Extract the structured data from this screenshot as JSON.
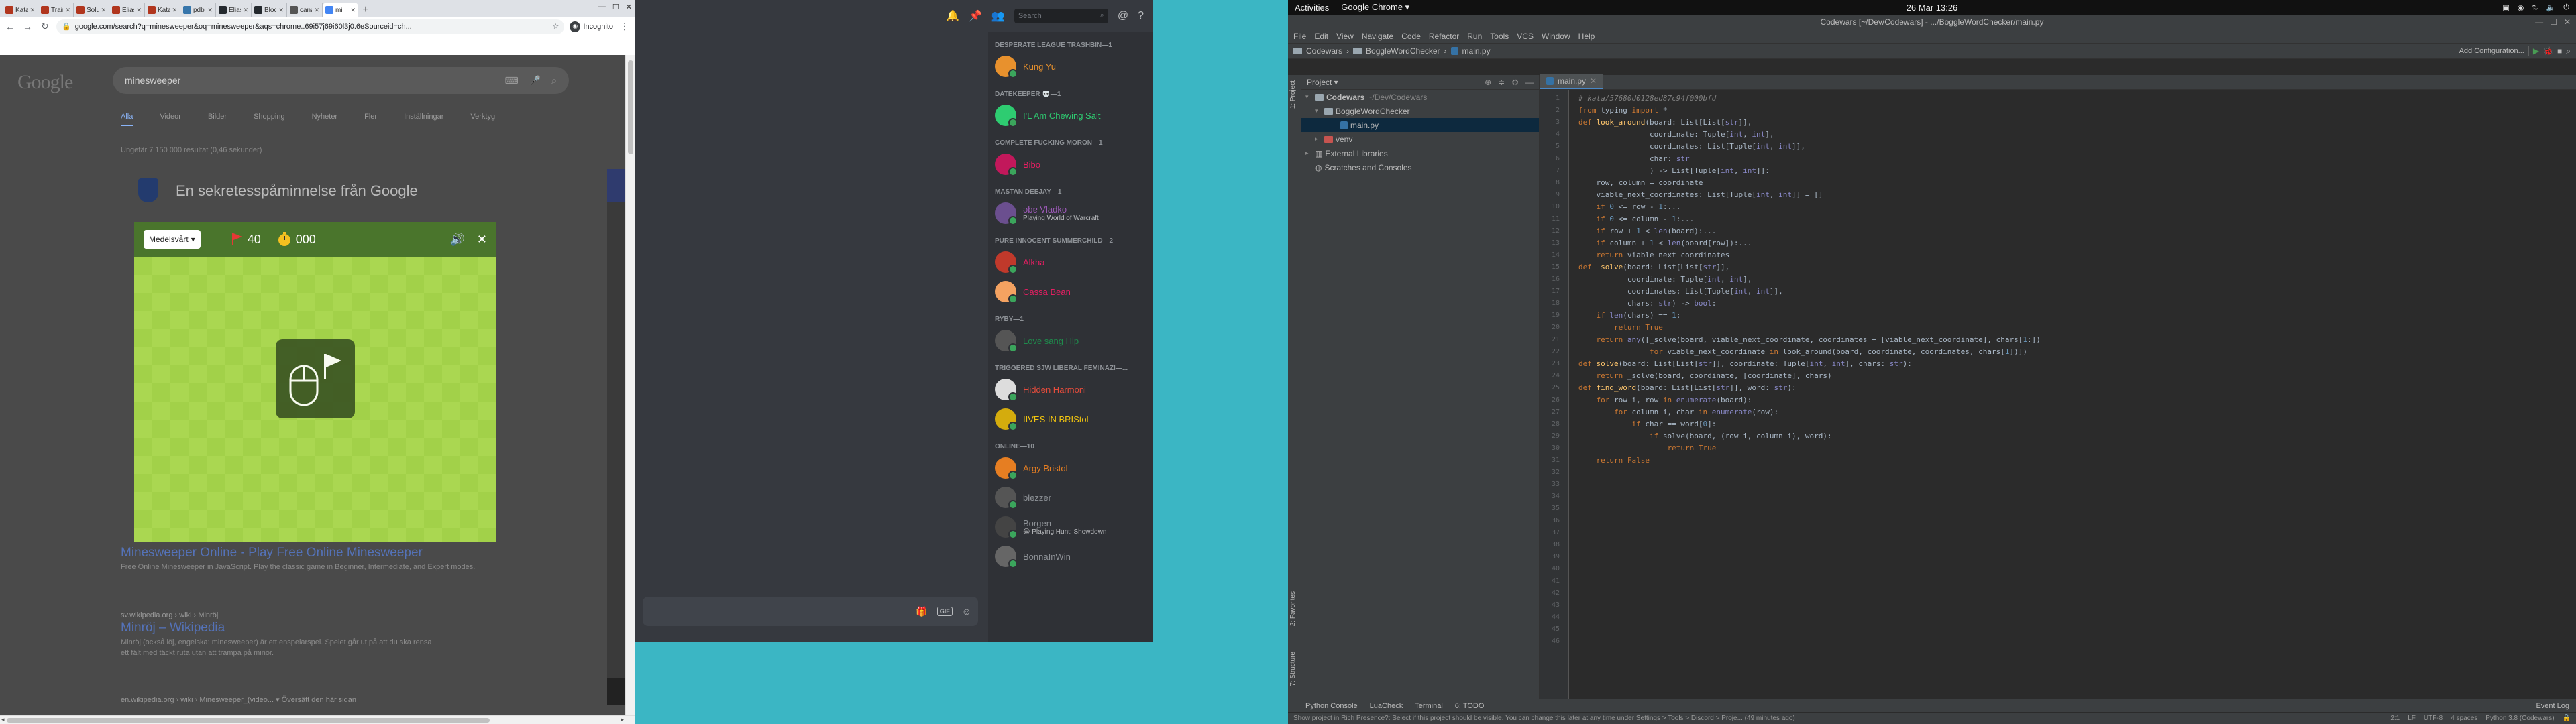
{
  "chrome": {
    "tabs": [
      {
        "label": "Kata |",
        "color": "#b1361e"
      },
      {
        "label": "Train",
        "color": "#b1361e"
      },
      {
        "label": "Solut",
        "color": "#b1361e"
      },
      {
        "label": "Elias",
        "color": "#b1361e"
      },
      {
        "label": "Kata |",
        "color": "#b1361e"
      },
      {
        "label": "pdb -",
        "color": "#3776ab"
      },
      {
        "label": "Elias",
        "color": "#24292e"
      },
      {
        "label": "Block",
        "color": "#24292e"
      },
      {
        "label": "cana",
        "color": "#555555"
      },
      {
        "label": "mi",
        "color": "#4285f4",
        "active": true
      }
    ],
    "url": "google.com/search?q=minesweeper&oq=minesweeper&aqs=chrome..69i57j69i60l3j0.6eSourceid=ch...",
    "profile": "Incognito",
    "search_query": "minesweeper",
    "nav_tabs": [
      "Alla",
      "Videor",
      "Bilder",
      "Shopping",
      "Nyheter",
      "Fler",
      "Inställningar",
      "Verktyg"
    ],
    "result_stats": "Ungefär 7 150 000 resultat (0,46 sekunder)",
    "privacy_title": "En sekretesspåminnelse från Google",
    "result1": {
      "title": "Minesweeper Online - Play Free Online Minesweeper",
      "desc": "Free Online Minesweeper in JavaScript. Play the classic game in Beginner, Intermediate, and Expert modes."
    },
    "result2": {
      "source": "sv.wikipedia.org › wiki › Minröj",
      "title": "Minröj – Wikipedia",
      "desc1": "Minröj (också löj, engelska: minesweeper) är ett enspelarspel. Spelet går ut på att du ska rensa",
      "desc2": "ett fält med täckt ruta utan att trampa på minor."
    },
    "footer_text": "en.wikipedia.org › wiki › Minesweeper_(video... ▾ Översätt den här sidan"
  },
  "minesweeper": {
    "difficulty": "Medelsvårt",
    "flags": "40",
    "timer": "000"
  },
  "discord": {
    "search_placeholder": "Search",
    "groups": [
      {
        "header": "DESPERATE LEAGUE TRASHBIN—1",
        "members": [
          {
            "name": "Kung Yu",
            "status": "",
            "color": "#e8912d",
            "avatar": "#e8912d"
          }
        ]
      },
      {
        "header": "DATEKEEPER 💀—1",
        "members": [
          {
            "name": "I'L Am Chewing Salt",
            "status": "",
            "color": "#2ecc71",
            "avatar": "#2ecc71"
          }
        ]
      },
      {
        "header": "COMPLETE FUCKING MORON—1",
        "members": [
          {
            "name": "Bibo",
            "status": "",
            "color": "#e91e63",
            "avatar": "#c2185b"
          }
        ]
      },
      {
        "header": "MASTAN DEEJAY—1",
        "members": [
          {
            "name": "ǝbɐ Vladko",
            "status": "Playing World of Warcraft",
            "color": "#9b59b6",
            "avatar": "#6b4f8f"
          }
        ]
      },
      {
        "header": "PURE INNOCENT SUMMERCHILD—2",
        "members": [
          {
            "name": "Alkha",
            "status": "",
            "color": "#e91e63",
            "avatar": "#c0392b"
          },
          {
            "name": "Cassa Bean",
            "status": "",
            "color": "#e91e63",
            "avatar": "#f4a261"
          }
        ]
      },
      {
        "header": "RYBY—1",
        "members": [
          {
            "name": "Love sang Hip",
            "status": "",
            "color": "#1f8b4c",
            "avatar": "#555555"
          }
        ]
      },
      {
        "header": "TRIGGERED SJW LIBERAL FEMINAZI—...",
        "members": [
          {
            "name": "Hidden Harmoni",
            "status": "",
            "color": "#e74c3c",
            "avatar": "#dddddd"
          },
          {
            "name": "IIVES IN BRIStol",
            "status": "",
            "color": "#f1c40f",
            "avatar": "#d4ac0d"
          }
        ]
      },
      {
        "header": "ONLINE—10",
        "members": [
          {
            "name": "Argy Bristol",
            "status": "",
            "color": "#e67e22",
            "avatar": "#e67e22"
          },
          {
            "name": "blezzer",
            "status": "",
            "color": "#8e9297",
            "avatar": "#555555"
          },
          {
            "name": "Borgen",
            "status": "😁 Playing Hunt: Showdown",
            "color": "#8e9297",
            "avatar": "#444444"
          },
          {
            "name": "BonnaInWin",
            "status": "",
            "color": "#8e9297",
            "avatar": "#666666"
          }
        ]
      }
    ]
  },
  "gnome": {
    "activities": "Activities",
    "app": "Google Chrome ▾",
    "clock": "26 Mar  13:26"
  },
  "intellij": {
    "title": "Codewars [~/Dev/Codewars] - .../BoggleWordChecker/main.py",
    "menu": [
      "File",
      "Edit",
      "View",
      "Navigate",
      "Code",
      "Refactor",
      "Run",
      "Tools",
      "VCS",
      "Window",
      "Help"
    ],
    "breadcrumbs": [
      "Codewars",
      "BoggleWordChecker",
      "main.py"
    ],
    "run_config": "Add Configuration...",
    "project_label": "Project ▾",
    "tree": [
      {
        "label": "Codewars",
        "extra": "~/Dev/Codewars",
        "indent": 6,
        "type": "folder"
      },
      {
        "label": "BoggleWordChecker",
        "extra": "",
        "indent": 20,
        "type": "folder"
      },
      {
        "label": "main.py",
        "extra": "",
        "indent": 44,
        "type": "py",
        "selected": true
      },
      {
        "label": "venv",
        "extra": "",
        "indent": 20,
        "type": "folder-red"
      },
      {
        "label": "External Libraries",
        "extra": "",
        "indent": 6,
        "type": "lib"
      },
      {
        "label": "Scratches and Consoles",
        "extra": "",
        "indent": 6,
        "type": "scratch"
      }
    ],
    "editor_tab": "main.py",
    "side_labels": [
      "1: Project",
      "2: Favorites",
      "7: Structure"
    ],
    "bottom_tools": [
      "Python Console",
      "6: TODO",
      "Terminal",
      "LuaCheck"
    ],
    "event_log": "Event Log",
    "status_left": "Show project in Rich Presence?: Select if this project should be visible. You can change this later at any time under Settings > Tools > Discord > Proje... (49 minutes ago)",
    "status_right": [
      "2:1",
      "LF",
      "UTF-8",
      "4 spaces",
      "Python 3.8 (Codewars)"
    ],
    "code_lines": [
      "# kata/57680d0128ed87c94f000bfd",
      "from typing import *",
      "",
      "",
      "def look_around(board: List[List[str]],",
      "                coordinate: Tuple[int, int],",
      "                coordinates: List[Tuple[int, int]],",
      "                char: str",
      "                ) -> List[Tuple[int, int]]:",
      "",
      "    row, column = coordinate",
      "    viable_next_coordinates: List[Tuple[int, int]] = []",
      "",
      "    if 0 <= row - 1:...",
      "",
      "    if 0 <= column - 1:...",
      "",
      "    if row + 1 < len(board):...",
      "",
      "    if column + 1 < len(board[row]):...",
      "",
      "    return viable_next_coordinates",
      "",
      "",
      "def _solve(board: List[List[str]],",
      "           coordinate: Tuple[int, int],",
      "           coordinates: List[Tuple[int, int]],",
      "           chars: str) -> bool:",
      "    if len(chars) == 1:",
      "        return True",
      "",
      "    return any([_solve(board, viable_next_coordinate, coordinates + [viable_next_coordinate], chars[1:])",
      "                for viable_next_coordinate in look_around(board, coordinate, coordinates, chars[1])])",
      "",
      "",
      "def solve(board: List[List[str]], coordinate: Tuple[int, int], chars: str):",
      "    return _solve(board, coordinate, [coordinate], chars)",
      "",
      "",
      "def find_word(board: List[List[str]], word: str):",
      "    for row_i, row in enumerate(board):",
      "        for column_i, char in enumerate(row):",
      "            if char == word[0]:",
      "                if solve(board, (row_i, column_i), word):",
      "                    return True",
      "    return False"
    ]
  }
}
